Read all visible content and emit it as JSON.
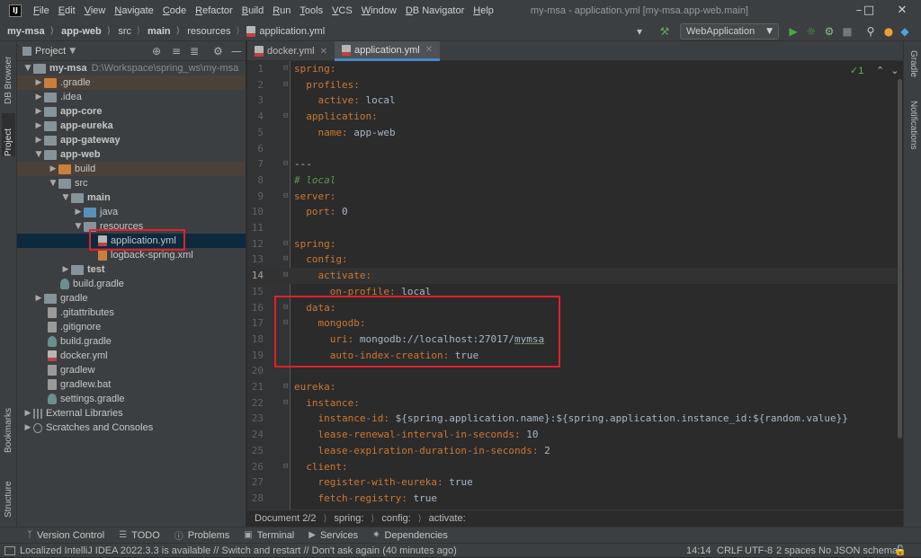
{
  "app": {
    "logo_text": "IJ",
    "window_title": "my-msa - application.yml [my-msa.app-web.main]",
    "menu": [
      "File",
      "Edit",
      "View",
      "Navigate",
      "Code",
      "Refactor",
      "Build",
      "Run",
      "Tools",
      "VCS",
      "Window",
      "DB Navigator",
      "Help"
    ]
  },
  "navbar": {
    "breadcrumbs": [
      "my-msa",
      "app-web",
      "src",
      "main",
      "resources",
      "application.yml"
    ],
    "run_config": "WebApplication"
  },
  "left_strip": {
    "tabs": [
      "DB Browser",
      "Project",
      "Bookmarks",
      "Structure"
    ]
  },
  "right_strip": {
    "tabs": [
      "Gradle",
      "Notifications"
    ]
  },
  "project": {
    "header_label": "Project",
    "root_name": "my-msa",
    "root_path": "D:\\Workspace\\spring_ws\\my-msa",
    "items": [
      ".gradle",
      ".idea",
      "app-core",
      "app-eureka",
      "app-gateway",
      "app-web",
      "build",
      "src",
      "main",
      "java",
      "resources",
      "application.yml",
      "logback-spring.xml",
      "test",
      "build.gradle",
      "gradle",
      ".gitattributes",
      ".gitignore",
      "build.gradle",
      "docker.yml",
      "gradlew",
      "gradlew.bat",
      "settings.gradle",
      "External Libraries",
      "Scratches and Consoles"
    ]
  },
  "editor": {
    "tabs": [
      {
        "label": "docker.yml"
      },
      {
        "label": "application.yml"
      }
    ],
    "inspection_count": "1",
    "current_line": 14,
    "lines": [
      [
        [
          "spring:",
          "k"
        ]
      ],
      [
        [
          "  profiles:",
          "k"
        ]
      ],
      [
        [
          "    active:",
          "k"
        ],
        [
          " local",
          "v"
        ]
      ],
      [
        [
          "  application:",
          "k"
        ]
      ],
      [
        [
          "    name:",
          "k"
        ],
        [
          " app-web",
          "v"
        ]
      ],
      [],
      [
        [
          "---",
          "v"
        ]
      ],
      [
        [
          "# local",
          "c"
        ]
      ],
      [
        [
          "server:",
          "k"
        ]
      ],
      [
        [
          "  port:",
          "k"
        ],
        [
          " 0",
          "v"
        ]
      ],
      [],
      [
        [
          "spring:",
          "k"
        ]
      ],
      [
        [
          "  config:",
          "k"
        ]
      ],
      [
        [
          "    activate:",
          "k"
        ]
      ],
      [
        [
          "      on-profile:",
          "k"
        ],
        [
          " local",
          "v"
        ]
      ],
      [
        [
          "  data:",
          "k"
        ]
      ],
      [
        [
          "    mongodb:",
          "k"
        ]
      ],
      [
        [
          "      uri:",
          "k"
        ],
        [
          " mongodb://localhost:27017/",
          "v"
        ],
        [
          "mymsa",
          "v u"
        ]
      ],
      [
        [
          "      auto-index-creation:",
          "k"
        ],
        [
          " true",
          "v"
        ]
      ],
      [],
      [
        [
          "eureka:",
          "k"
        ]
      ],
      [
        [
          "  instance:",
          "k"
        ]
      ],
      [
        [
          "    instance-id:",
          "k"
        ],
        [
          " ${spring.application.name}:${spring.application.instance_id:${random.value}}",
          "v"
        ]
      ],
      [
        [
          "    lease-renewal-interval-in-seconds:",
          "k"
        ],
        [
          " 10",
          "v"
        ]
      ],
      [
        [
          "    lease-expiration-duration-in-seconds:",
          "k"
        ],
        [
          " 2",
          "v"
        ]
      ],
      [
        [
          "  client:",
          "k"
        ]
      ],
      [
        [
          "    register-with-eureka:",
          "k"
        ],
        [
          " true",
          "v"
        ]
      ],
      [
        [
          "    fetch-registry:",
          "k"
        ],
        [
          " true",
          "v"
        ]
      ]
    ]
  },
  "editor_breadcrumbs": [
    "Document 2/2",
    "spring:",
    "config:",
    "activate:"
  ],
  "tool_tabs": [
    "Version Control",
    "TODO",
    "Problems",
    "Terminal",
    "Services",
    "Dependencies"
  ],
  "status": {
    "message": "Localized IntelliJ IDEA 2022.3.3 is available // Switch and restart // Don't ask again (40 minutes ago)",
    "position": "14:14",
    "line_sep": "CRLF",
    "encoding": "UTF-8",
    "indent": "2 spaces",
    "schema": "No JSON schema"
  },
  "colors": {
    "highlight_box": "#e2202b",
    "keyword": "#cc7832",
    "value": "#a9b7c6",
    "comment": "#629755",
    "selection": "#0d293e"
  }
}
